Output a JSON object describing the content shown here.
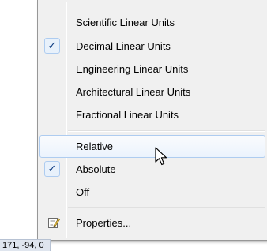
{
  "menu": {
    "items": [
      {
        "label": "Scientific Linear Units",
        "checked": false
      },
      {
        "label": "Decimal Linear Units",
        "checked": true
      },
      {
        "label": "Engineering Linear Units",
        "checked": false
      },
      {
        "label": "Architectural Linear Units",
        "checked": false
      },
      {
        "label": "Fractional Linear Units",
        "checked": false
      }
    ],
    "coord_modes": [
      {
        "label": "Relative",
        "checked": false,
        "hovered": true
      },
      {
        "label": "Absolute",
        "checked": true
      },
      {
        "label": "Off",
        "checked": false
      }
    ],
    "properties": {
      "label": "Properties...",
      "icon": "properties-icon"
    }
  },
  "check_glyph": "✓",
  "status_bar": {
    "coordinates": "171, -94, 0"
  }
}
